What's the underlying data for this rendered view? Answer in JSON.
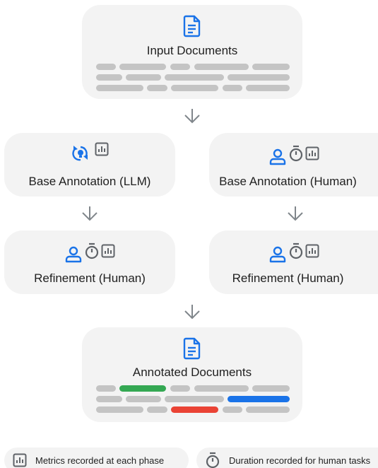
{
  "colors": {
    "box_bg": "#f3f3f3",
    "blue": "#1a73e8",
    "gray_icon": "#5f6368",
    "bar_gray": "#c4c4c4",
    "bar_green": "#34a853",
    "bar_blue": "#1a73e8",
    "bar_red": "#ea4335",
    "arrow": "#80868b"
  },
  "nodes": {
    "input": {
      "title": "Input Documents",
      "icons": [
        "document-icon"
      ]
    },
    "base_llm": {
      "title": "Base Annotation (LLM)",
      "icons": [
        "ai-bulb-icon",
        "metrics-icon"
      ]
    },
    "base_human": {
      "title": "Base Annotation (Human)",
      "icons": [
        "person-icon",
        "timer-icon",
        "metrics-icon"
      ]
    },
    "refine_left": {
      "title": "Refinement (Human)",
      "icons": [
        "person-icon",
        "timer-icon",
        "metrics-icon"
      ]
    },
    "refine_right": {
      "title": "Refinement (Human)",
      "icons": [
        "person-icon",
        "timer-icon",
        "metrics-icon"
      ]
    },
    "output": {
      "title": "Annotated Documents",
      "icons": [
        "document-icon"
      ]
    }
  },
  "highlights": [
    "green",
    "blue",
    "red"
  ],
  "legend": {
    "metrics": {
      "icon": "metrics-icon",
      "text": "Metrics recorded at each phase"
    },
    "duration": {
      "icon": "timer-icon",
      "text": "Duration recorded for human tasks"
    }
  }
}
